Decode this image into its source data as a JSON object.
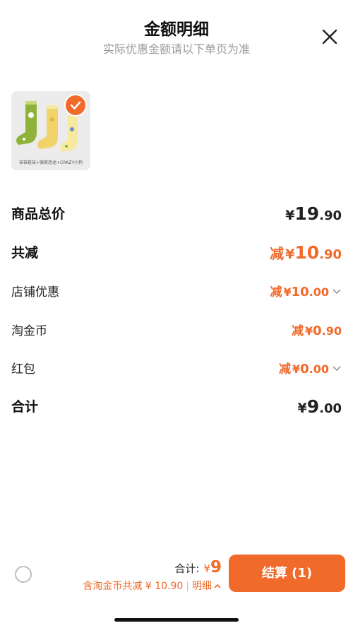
{
  "header": {
    "title": "金额明细",
    "subtitle": "实际优惠金额请以下单页为准"
  },
  "product": {
    "image_caption": "袜袜鞋袜+微笑恐龙+CRAZY小狗",
    "selected": true
  },
  "rows": {
    "goods_total": {
      "label": "商品总价",
      "currency": "¥",
      "int": "19",
      "dec": ".90"
    },
    "total_discount": {
      "label": "共减",
      "prefix": "减",
      "currency": "¥",
      "int": "10",
      "dec": ".90"
    },
    "shop_discount": {
      "label": "店铺优惠",
      "prefix": "减",
      "currency": "¥",
      "int": "10",
      "dec": ".00"
    },
    "taojinbi": {
      "label": "淘金币",
      "prefix": "减",
      "currency": "¥",
      "int": "0",
      "dec": ".90"
    },
    "hongbao": {
      "label": "红包",
      "prefix": "减",
      "currency": "¥",
      "int": "0",
      "dec": ".00"
    },
    "sum": {
      "label": "合计",
      "currency": "¥",
      "int": "9",
      "dec": ".00"
    }
  },
  "footer": {
    "total_label": "合计:",
    "total_currency": "¥",
    "total_value": "9",
    "savings_text": "含淘金币共减 ¥ 10.90",
    "separator": "|",
    "detail_label": "明细",
    "pay_button": "结算 (1)"
  },
  "colors": {
    "accent": "#f06a2a",
    "text": "#111111",
    "muted": "#9a9a9a"
  },
  "icons": [
    "close-icon",
    "check-icon",
    "chevron-down-icon",
    "chevron-up-icon",
    "select-all-radio"
  ]
}
